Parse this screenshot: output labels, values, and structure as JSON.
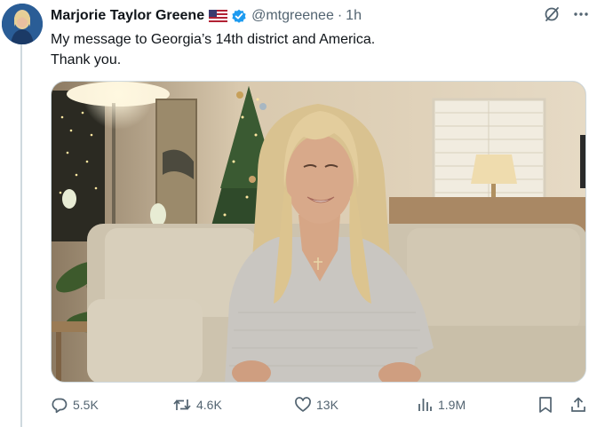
{
  "author": {
    "display_name": "Marjorie Taylor Greene",
    "handle": "@mtgreenee",
    "separator": "·",
    "time": "1h"
  },
  "tweet": {
    "lines": [
      "My message to Georgia’s 14th district and America.",
      "Thank you."
    ]
  },
  "actions": {
    "replies": "5.5K",
    "reposts": "4.6K",
    "likes": "13K",
    "views": "1.9M"
  },
  "icons": {
    "flag": "us-flag-icon",
    "verified": "verified-badge-icon",
    "grok": "grok-icon",
    "more": "more-icon",
    "reply": "reply-icon",
    "repost": "repost-icon",
    "like": "heart-icon",
    "views": "views-icon",
    "bookmark": "bookmark-icon",
    "share": "share-icon"
  },
  "colors": {
    "text": "#0f1419",
    "secondary": "#536471",
    "verified": "#1d9bf0",
    "border": "#cfd9de"
  }
}
